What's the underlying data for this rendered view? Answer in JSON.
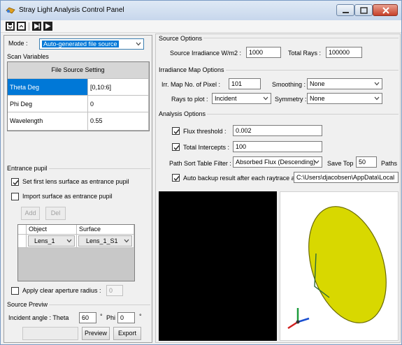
{
  "window": {
    "title": "Stray Light Analysis Control Panel"
  },
  "toolbar": {
    "buttons": [
      "save-icon",
      "open-icon",
      "step-icon",
      "play-icon"
    ]
  },
  "left": {
    "mode_label": "Mode :",
    "mode_value": "Auto-generated file source",
    "scan_variables_label": "Scan Variables",
    "file_source_header": "File Source Setting",
    "rows": [
      {
        "name": "Theta Deg",
        "value": "[0,10:6]"
      },
      {
        "name": "Phi Deg",
        "value": "0"
      },
      {
        "name": "Wavelength",
        "value": "0.55"
      }
    ],
    "entrance_pupil": {
      "title": "Entrance pupil",
      "set_first_lens": "Set first lens surface as entrance pupil",
      "import_surface": "Import surface as entrance pupil",
      "add_label": "Add",
      "del_label": "Del",
      "col_object": "Object",
      "col_surface": "Surface",
      "row_object": "Lens_1",
      "row_surface": "Lens_1_S1",
      "apply_clear_aperture": "Apply clear aperture radius :",
      "clear_aperture_value": "0"
    },
    "source_preview": {
      "title": "Source Previw",
      "incident_label": "Incident angle : Theta",
      "theta_value": "60",
      "deg1": "°",
      "phi_label": "Phi",
      "phi_value": "0",
      "deg2": "°",
      "preview_label": "Preview",
      "export_label": "Export"
    }
  },
  "source_options": {
    "title": "Source Options",
    "irradiance_label": "Source Irradiance W/m2 :",
    "irradiance_value": "1000",
    "total_rays_label": "Total Rays :",
    "total_rays_value": "100000"
  },
  "irradiance_map": {
    "title": "Irradiance Map Options",
    "pixel_label": "Irr. Map No. of Pixel :",
    "pixel_value": "101",
    "smoothing_label": "Smoothing :",
    "smoothing_value": "None",
    "rays_label": "Rays to plot :",
    "rays_value": "Incident",
    "symmetry_label": "Symmetry :",
    "symmetry_value": "None"
  },
  "analysis": {
    "title": "Analysis Options",
    "flux_label": "Flux threshold :",
    "flux_value": "0.002",
    "intercepts_label": "Total Intercepts :",
    "intercepts_value": "100",
    "path_sort_label": "Path Sort Table Filter :",
    "path_sort_value": "Absorbed Flux (Descending)",
    "save_top_label": "Save Top",
    "save_top_value": "50",
    "paths_label": "Paths",
    "auto_backup_label": "Auto backup result after each raytrace at:",
    "auto_backup_path": "C:\\Users\\djacobsen\\AppData\\Local"
  },
  "colors": {
    "selection": "#0078d7",
    "ellipse": "#d8d800",
    "viewport_black": "#000000"
  }
}
